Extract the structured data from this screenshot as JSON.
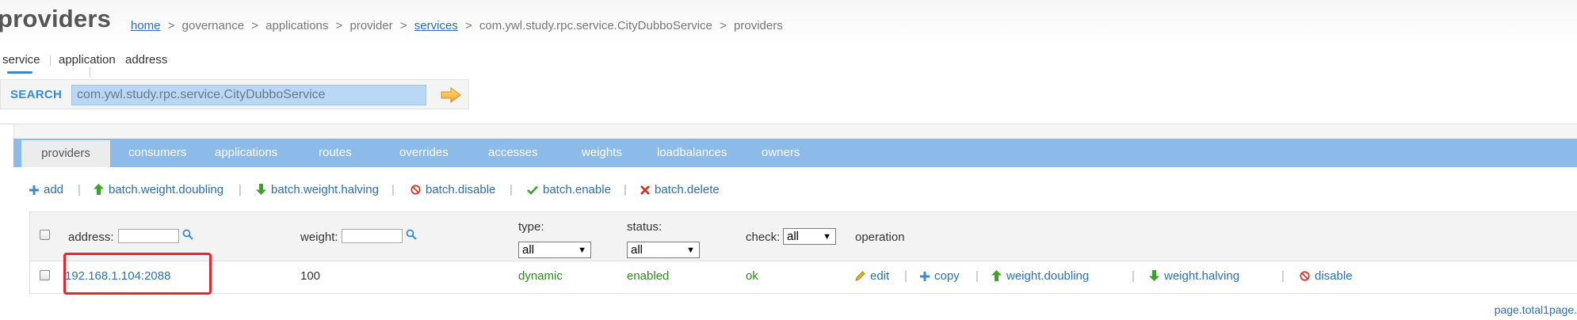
{
  "page": {
    "title": "providers"
  },
  "breadcrumb": {
    "home": "home",
    "governance": "governance",
    "applications": "applications",
    "provider": "provider",
    "services": "services",
    "service_name": "com.ywl.study.rpc.service.CityDubboService",
    "current": "providers",
    "separator": ">"
  },
  "subtabs": {
    "service": "service",
    "application": "application",
    "address": "address"
  },
  "search": {
    "label": "SEARCH",
    "value": "com.ywl.study.rpc.service.CityDubboService"
  },
  "tabs": [
    "providers",
    "consumers",
    "applications",
    "routes",
    "overrides",
    "accesses",
    "weights",
    "loadbalances",
    "owners"
  ],
  "toolbar": {
    "add": "add",
    "batch_weight_doubling": "batch.weight.doubling",
    "batch_weight_halving": "batch.weight.halving",
    "batch_disable": "batch.disable",
    "batch_enable": "batch.enable",
    "batch_delete": "batch.delete",
    "separator": "|"
  },
  "table": {
    "headers": {
      "address": "address:",
      "weight": "weight:",
      "type": "type:",
      "status": "status:",
      "check": "check:",
      "operation": "operation"
    },
    "filters": {
      "type": "all",
      "status": "all",
      "check": "all"
    },
    "rows": [
      {
        "address": "192.168.1.104:2088",
        "weight": "100",
        "type": "dynamic",
        "status": "enabled",
        "check": "ok",
        "ops": {
          "edit": "edit",
          "copy": "copy",
          "weight_doubling": "weight.doubling",
          "weight_halving": "weight.halving",
          "disable": "disable"
        }
      }
    ]
  },
  "pager": {
    "text": "page.total1page."
  },
  "colors": {
    "tab_bar": "#8cbbea",
    "link": "#2a6fb3",
    "status_green": "#2a8a1a",
    "highlight_box": "#e8262d"
  },
  "icons": {
    "search_go": "arrow-right-icon",
    "add": "plus-icon",
    "doubling": "arrow-up-icon",
    "halving": "arrow-down-icon",
    "disable": "ban-icon",
    "enable": "checkmark-icon",
    "delete": "x-icon",
    "edit": "pencil-icon",
    "filter_search": "magnifier-icon"
  }
}
